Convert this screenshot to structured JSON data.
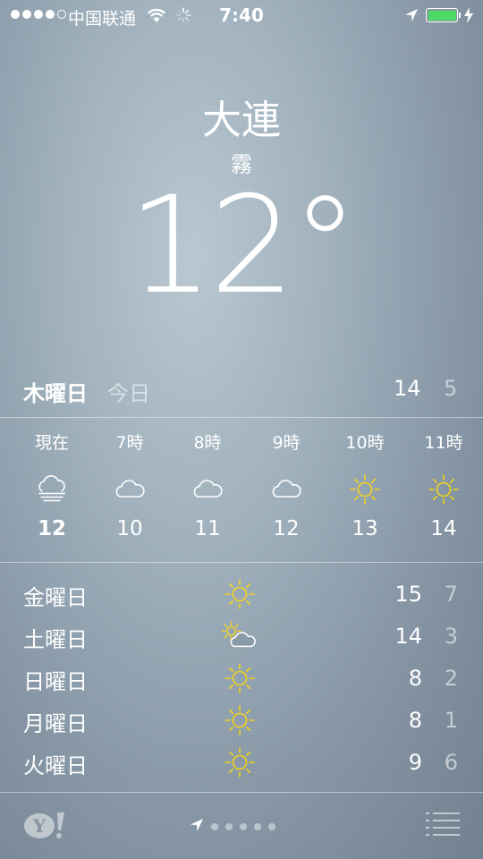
{
  "status_bar": {
    "carrier": "中国联通",
    "time": "7:40",
    "signal_bars_filled": 4,
    "signal_bars_total": 5,
    "battery_color": "#4cd964"
  },
  "location": {
    "city": "大連",
    "condition": "霧",
    "temperature": "12°"
  },
  "today": {
    "day": "木曜日",
    "label": "今日",
    "high": "14",
    "low": "5"
  },
  "hourly": [
    {
      "label": "現在",
      "icon": "fog-icon",
      "temp": "12"
    },
    {
      "label": "7時",
      "icon": "cloud-icon",
      "temp": "10"
    },
    {
      "label": "8時",
      "icon": "cloud-icon",
      "temp": "11"
    },
    {
      "label": "9時",
      "icon": "cloud-icon",
      "temp": "12"
    },
    {
      "label": "10時",
      "icon": "sun-icon",
      "temp": "13"
    },
    {
      "label": "11時",
      "icon": "sun-icon",
      "temp": "14"
    }
  ],
  "daily": [
    {
      "day": "金曜日",
      "icon": "sun-icon",
      "high": "15",
      "low": "7"
    },
    {
      "day": "土曜日",
      "icon": "partly-cloudy-icon",
      "high": "14",
      "low": "3"
    },
    {
      "day": "日曜日",
      "icon": "sun-icon",
      "high": "8",
      "low": "2"
    },
    {
      "day": "月曜日",
      "icon": "sun-icon",
      "high": "8",
      "low": "1"
    },
    {
      "day": "火曜日",
      "icon": "sun-icon",
      "high": "9",
      "low": "6"
    }
  ],
  "footer": {
    "page_count": 5,
    "current_page": "location"
  },
  "colors": {
    "sun": "#f5d31e",
    "text": "#ffffff",
    "muted": "rgba(255,255,255,0.55)"
  }
}
